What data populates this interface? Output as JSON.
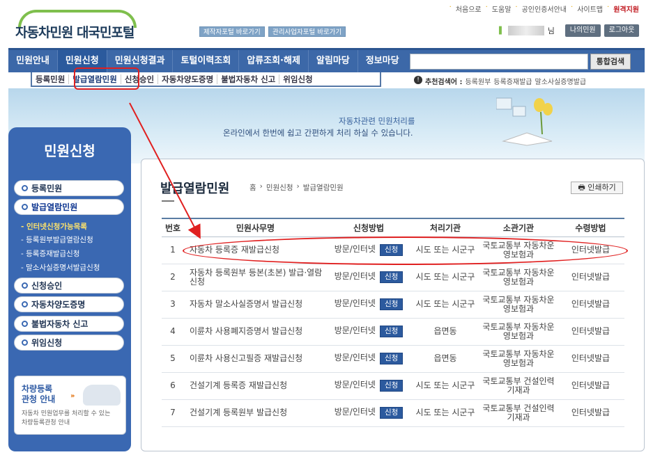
{
  "header": {
    "logo": "자동차민원 대국민포털",
    "top_links": [
      "처음으로",
      "도움말",
      "공인인증서안내",
      "사이트맵",
      "원격지원"
    ],
    "portal_buttons": [
      "제작자포털 바로가기",
      "관리사업자포털 바로가기"
    ],
    "user_suffix": "님",
    "my_button": "나의민원",
    "logout_button": "로그아웃"
  },
  "nav": {
    "items": [
      "민원안내",
      "민원신청",
      "민원신청결과",
      "토털이력조회",
      "압류조회·해제",
      "알림마당",
      "정보마당"
    ],
    "active_index": 1,
    "search_button": "통합검색"
  },
  "subnav": {
    "items": [
      "등록민원",
      "발급열람민원",
      "신청승인",
      "자동차양도증명",
      "불법자동차 신고",
      "위임신청"
    ],
    "active_index": 1
  },
  "recommend": {
    "label": "추천검색어 :",
    "keywords": [
      "등록원부",
      "등록증재발급",
      "말소사실증명발급"
    ]
  },
  "banner": {
    "line1": "자동차관련 민원처리를",
    "line2": "온라인에서 한번에 쉽고 간편하게 처리 하실 수 있습니다."
  },
  "sidebar": {
    "title": "민원신청",
    "items": [
      "등록민원",
      "발급열람민원",
      "신청승인",
      "자동차양도증명",
      "불법자동차 신고",
      "위임신청"
    ],
    "subitems": [
      "- 인터넷신청가능목록",
      "- 등록원부발급열람신청",
      "- 등록증재발급신청",
      "- 말소사실증명서발급신청"
    ],
    "box_title_1": "차량등록",
    "box_title_2": "관청 안내",
    "box_desc_1": "자동차 민원업무를 처리할 수 있는",
    "box_desc_2": "차량등록관청 안내"
  },
  "content": {
    "title": "발급열람민원",
    "breadcrumb": [
      "홈",
      "민원신청",
      "발급열람민원"
    ],
    "print_button": "인쇄하기",
    "columns": [
      "번호",
      "민원사무명",
      "신청방법",
      "처리기관",
      "소관기관",
      "수령방법"
    ],
    "apply_label": "신청",
    "rows": [
      {
        "no": "1",
        "name": "자동차 등록증 재발급신청",
        "method": "방문/인터넷",
        "proc": "시도 또는 시군구",
        "org": "국토교통부 자동차운영보험과",
        "receive": "인터넷발급"
      },
      {
        "no": "2",
        "name": "자동차 등록원부 등본(초본) 발급·열람신청",
        "method": "방문/인터넷",
        "proc": "시도 또는 시군구",
        "org": "국토교통부 자동차운영보험과",
        "receive": "인터넷발급"
      },
      {
        "no": "3",
        "name": "자동차 말소사실증명서 발급신청",
        "method": "방문/인터넷",
        "proc": "시도 또는 시군구",
        "org": "국토교통부 자동차운영보험과",
        "receive": "인터넷발급"
      },
      {
        "no": "4",
        "name": "이륜차 사용폐지증명서 발급신청",
        "method": "방문/인터넷",
        "proc": "읍면동",
        "org": "국토교통부 자동차운영보험과",
        "receive": "인터넷발급"
      },
      {
        "no": "5",
        "name": "이륜차 사용신고필증 재발급신청",
        "method": "방문/인터넷",
        "proc": "읍면동",
        "org": "국토교통부 자동차운영보험과",
        "receive": "인터넷발급"
      },
      {
        "no": "6",
        "name": "건설기계 등록증 재발급신청",
        "method": "방문/인터넷",
        "proc": "시도 또는 시군구",
        "org": "국토교통부 건설인력기재과",
        "receive": "인터넷발급"
      },
      {
        "no": "7",
        "name": "건설기계 등록원부 발급신청",
        "method": "방문/인터넷",
        "proc": "시도 또는 시군구",
        "org": "국토교통부 건설인력기재과",
        "receive": "인터넷발급"
      }
    ]
  }
}
